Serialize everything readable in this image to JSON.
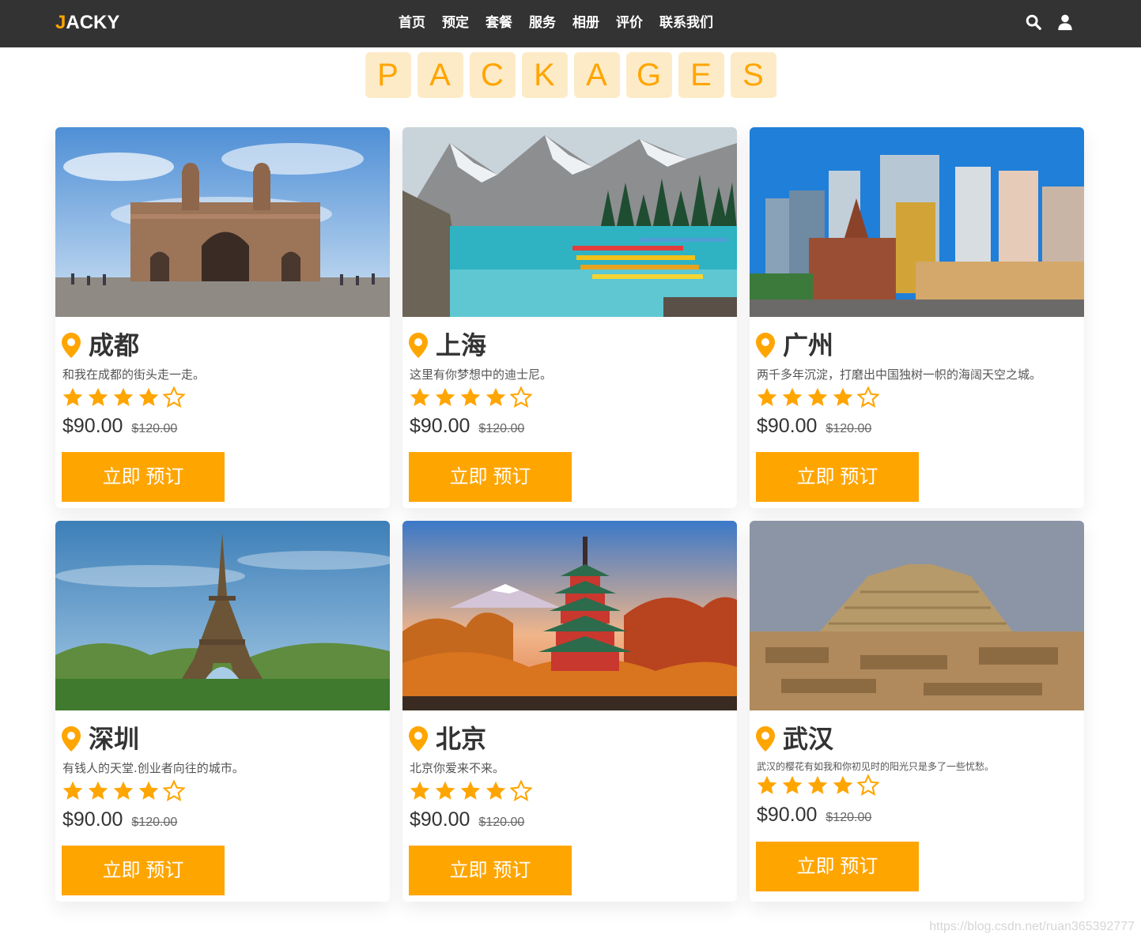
{
  "header": {
    "logo_accent": "J",
    "logo_rest": "ACKY",
    "nav": [
      "首页",
      "预定",
      "套餐",
      "服务",
      "相册",
      "评价",
      "联系我们"
    ],
    "icons": [
      "search-icon",
      "user-icon"
    ]
  },
  "heading": {
    "letters": [
      "P",
      "A",
      "C",
      "K",
      "A",
      "G",
      "E",
      "S"
    ]
  },
  "packages": [
    {
      "city": "成都",
      "desc": "和我在成都的街头走一走。",
      "rating": 4,
      "max_rating": 5,
      "price": "$90.00",
      "old_price": "$120.00",
      "button": "立即 预订"
    },
    {
      "city": "上海",
      "desc": "这里有你梦想中的迪士尼。",
      "rating": 4,
      "max_rating": 5,
      "price": "$90.00",
      "old_price": "$120.00",
      "button": "立即 预订"
    },
    {
      "city": "广州",
      "desc": "两千多年沉淀，打磨出中国独树一帜的海阔天空之城。",
      "rating": 4,
      "max_rating": 5,
      "price": "$90.00",
      "old_price": "$120.00",
      "button": "立即 预订"
    },
    {
      "city": "深圳",
      "desc": "有钱人的天堂.创业者向往的城市。",
      "rating": 4,
      "max_rating": 5,
      "price": "$90.00",
      "old_price": "$120.00",
      "button": "立即 预订"
    },
    {
      "city": "北京",
      "desc": "北京你爱来不来。",
      "rating": 4,
      "max_rating": 5,
      "price": "$90.00",
      "old_price": "$120.00",
      "button": "立即 预订"
    },
    {
      "city": "武汉",
      "desc": "武汉的樱花有如我和你初见时的阳光只是多了一些忧愁。",
      "rating": 4,
      "max_rating": 5,
      "price": "$90.00",
      "old_price": "$120.00",
      "button": "立即 预订"
    }
  ],
  "watermark": "https://blog.csdn.net/ruan365392777",
  "colors": {
    "accent": "#ffa500",
    "header_bg": "#333333",
    "heading_tile": "#fdebc8"
  }
}
